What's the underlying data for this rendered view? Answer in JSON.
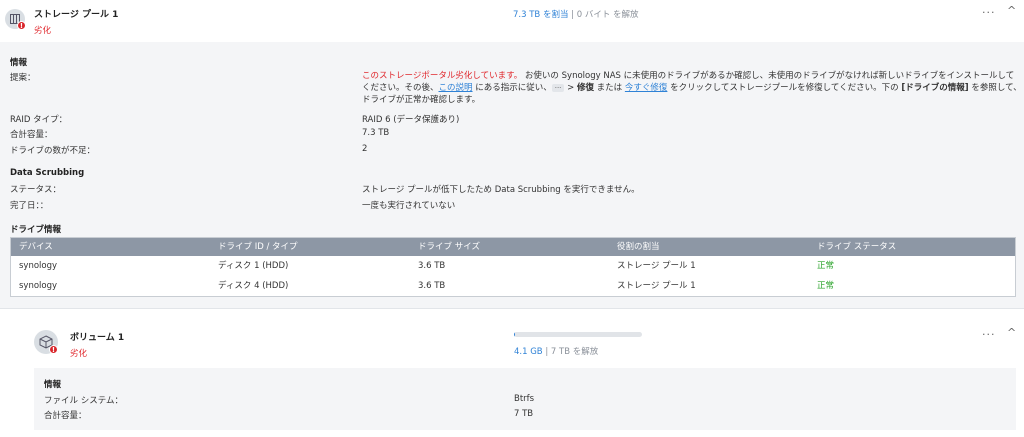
{
  "pool": {
    "title": "ストレージ プール 1",
    "status": "劣化",
    "warn_badge": "!",
    "allocated": "7.3 TB を割当",
    "separator": "|",
    "free": "0 バイト を解放",
    "more": "···",
    "collapse": "^",
    "info": {
      "section_title": "情報",
      "suggestion_label": "提案：",
      "suggestion_warning": "このストレージポータル劣化しています。",
      "suggestion_text1": " お使いの Synology NAS に未使用のドライブがあるか確認し、未使用のドライブがなければ新しいドライブをインストールしてください。その後、",
      "suggestion_link1": "この説明",
      "suggestion_text2": " にある指示に従い、",
      "suggestion_chip": "···",
      "suggestion_text3": " > ",
      "suggestion_bold1": "修復",
      "suggestion_text4": " または ",
      "suggestion_link2": "今すぐ修復",
      "suggestion_text5": " をクリックしてストレージプールを修復してください。下の ",
      "suggestion_bold2": "[ドライブの情報]",
      "suggestion_text6": " を参照して、ドライブが正常か確認します。",
      "raid_label": "RAID タイプ：",
      "raid_value": "RAID 6 (データ保護あり)",
      "capacity_label": "合計容量：",
      "capacity_value": "7.3 TB",
      "missing_label": "ドライブの数が不足：",
      "missing_value": "2"
    },
    "scrubbing": {
      "section_title": "Data Scrubbing",
      "status_label": "ステータス：",
      "status_value": "ストレージ プールが低下したため Data Scrubbing を実行できません。",
      "completed_label": "完了日：：",
      "completed_value": "一度も実行されていない"
    },
    "drives": {
      "section_title": "ドライブ情報",
      "headers": [
        "デバイス",
        "ドライブ ID / タイプ",
        "ドライブ サイズ",
        "役割の割当",
        "ドライブ ステータス"
      ],
      "rows": [
        [
          "synology",
          "ディスク 1 (HDD)",
          "3.6 TB",
          "ストレージ プール 1",
          "正常"
        ],
        [
          "synology",
          "ディスク 4 (HDD)",
          "3.6 TB",
          "ストレージ プール 1",
          "正常"
        ]
      ]
    }
  },
  "volume": {
    "title": "ボリューム 1",
    "status": "劣化",
    "warn_badge": "!",
    "usage_fraction": 0.006,
    "used": "4.1 GB",
    "separator": "|",
    "free": "7 TB を解放",
    "more": "···",
    "collapse": "^",
    "info": {
      "section_title": "情報",
      "fs_label": "ファイル システム：",
      "fs_value": "Btrfs",
      "capacity_label": "合計容量：",
      "capacity_value": "7 TB"
    }
  },
  "colors": {
    "accent": "#2f82d6",
    "danger": "#e0272c",
    "success": "#2aa32a",
    "table_header": "#8d97a5"
  }
}
